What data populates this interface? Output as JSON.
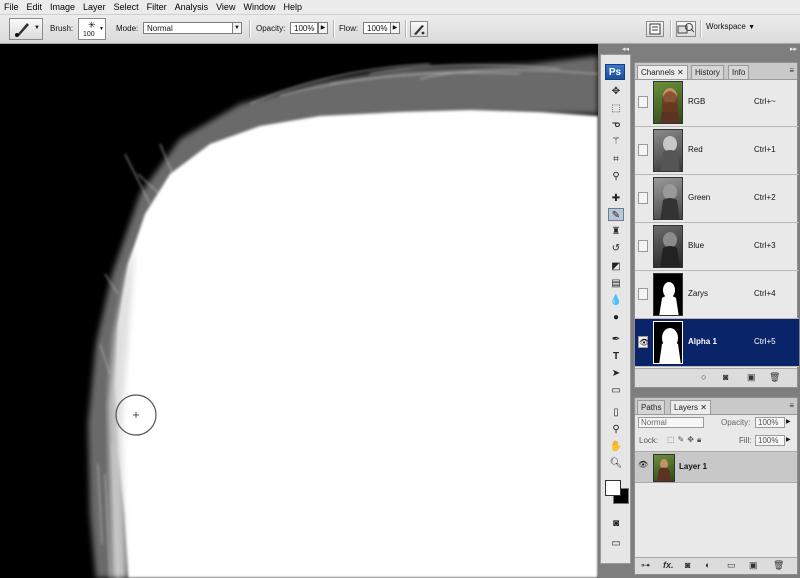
{
  "menu": [
    "File",
    "Edit",
    "Image",
    "Layer",
    "Select",
    "Filter",
    "Analysis",
    "View",
    "Window",
    "Help"
  ],
  "options": {
    "brush_label": "Brush:",
    "brush_size": "100",
    "mode_label": "Mode:",
    "mode_value": "Normal",
    "opacity_label": "Opacity:",
    "opacity_value": "100%",
    "flow_label": "Flow:",
    "flow_value": "100%",
    "workspace_label": "Workspace"
  },
  "toolbox": {
    "logo": "Ps",
    "tools": [
      "move-icon",
      "marquee-icon",
      "lasso-icon",
      "magic-wand-icon",
      "crop-icon",
      "eyedropper-icon",
      "healing-brush-icon",
      "brush-icon",
      "clone-stamp-icon",
      "history-brush-icon",
      "eraser-icon",
      "gradient-icon",
      "blur-icon",
      "dodge-icon",
      "pen-icon",
      "type-icon",
      "path-selection-icon",
      "shape-icon",
      "notes-icon",
      "eyedropper2-icon",
      "hand-icon",
      "zoom-icon"
    ]
  },
  "channels_panel": {
    "tabs": [
      "Channels",
      "History",
      "Info"
    ],
    "rows": [
      {
        "name": "RGB",
        "key": "Ctrl+~",
        "thumb": "color"
      },
      {
        "name": "Red",
        "key": "Ctrl+1",
        "thumb": "gray"
      },
      {
        "name": "Green",
        "key": "Ctrl+2",
        "thumb": "gray"
      },
      {
        "name": "Blue",
        "key": "Ctrl+3",
        "thumb": "gray"
      },
      {
        "name": "Zarys",
        "key": "Ctrl+4",
        "thumb": "mask"
      },
      {
        "name": "Alpha 1",
        "key": "Ctrl+5",
        "thumb": "mask",
        "selected": true
      }
    ]
  },
  "layers_panel": {
    "tabs": [
      "Paths",
      "Layers"
    ],
    "blend_mode": "Normal",
    "opacity_label": "Opacity:",
    "opacity_value": "100%",
    "lock_label": "Lock:",
    "fill_label": "Fill:",
    "fill_value": "100%",
    "layer_name": "Layer 1"
  },
  "colors": {
    "selection": "#0a246a",
    "panel": "#e9e9e9"
  }
}
